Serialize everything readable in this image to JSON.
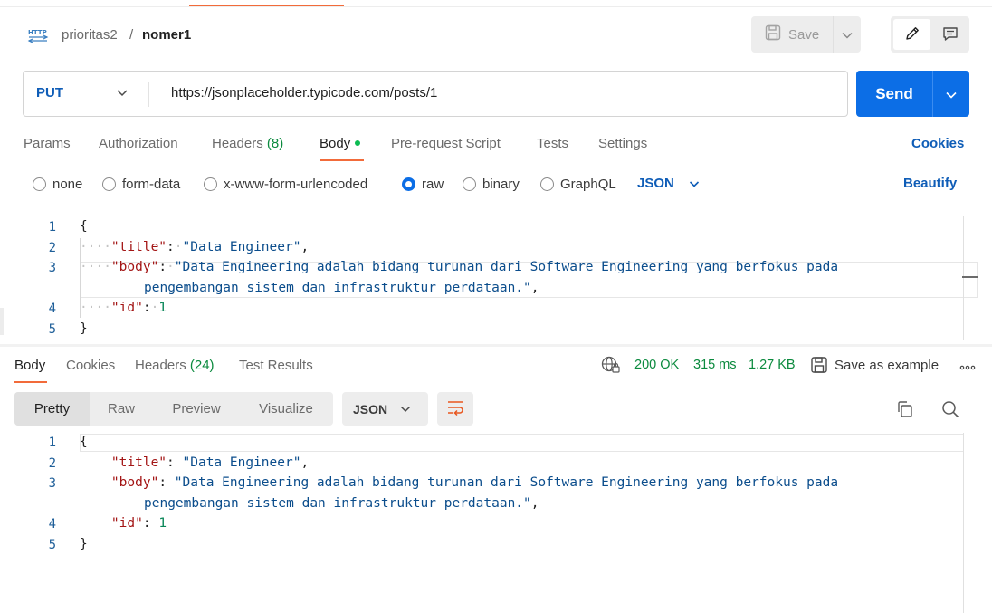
{
  "header": {
    "breadcrumb_parent": "prioritas2",
    "breadcrumb_separator": "/",
    "breadcrumb_current": "nomer1",
    "save_label": "Save"
  },
  "request": {
    "method": "PUT",
    "url": "https://jsonplaceholder.typicode.com/posts/1",
    "send_label": "Send"
  },
  "request_tabs": {
    "params": "Params",
    "authorization": "Authorization",
    "headers": "Headers",
    "headers_count": "(8)",
    "body": "Body",
    "pre_request": "Pre-request Script",
    "tests": "Tests",
    "settings": "Settings",
    "cookies": "Cookies"
  },
  "body_types": {
    "none": "none",
    "form_data": "form-data",
    "urlencoded": "x-www-form-urlencoded",
    "raw": "raw",
    "binary": "binary",
    "graphql": "GraphQL",
    "selected": "raw",
    "language": "JSON",
    "beautify": "Beautify"
  },
  "request_editor": {
    "line_numbers": [
      "1",
      "2",
      "3",
      "4",
      "5"
    ],
    "open_brace": "{",
    "close_brace": "}",
    "key_title": "\"title\"",
    "val_title": "\"Data Engineer\"",
    "key_body": "\"body\"",
    "val_body_1": "\"Data Engineering adalah bidang turunan dari Software Engineering yang berfokus pada",
    "val_body_2": "pengembangan sistem dan infrastruktur perdataan.\"",
    "key_id": "\"id\"",
    "val_id": "1"
  },
  "response_tabs": {
    "body": "Body",
    "cookies": "Cookies",
    "headers": "Headers",
    "headers_count": "(24)",
    "test_results": "Test Results"
  },
  "response_status": {
    "code": "200 OK",
    "time": "315 ms",
    "size": "1.27 KB",
    "save_example": "Save as example"
  },
  "response_view": {
    "pretty": "Pretty",
    "raw": "Raw",
    "preview": "Preview",
    "visualize": "Visualize",
    "language": "JSON"
  },
  "response_editor": {
    "line_numbers": [
      "1",
      "2",
      "3",
      "4",
      "5"
    ],
    "open_brace": "{",
    "close_brace": "}",
    "key_title": "\"title\"",
    "val_title": "\"Data Engineer\"",
    "key_body": "\"body\"",
    "val_body_1": "\"Data Engineering adalah bidang turunan dari Software Engineering yang berfokus pada",
    "val_body_2": "pengembangan sistem dan infrastruktur perdataan.\"",
    "key_id": "\"id\"",
    "val_id": "1"
  },
  "colors": {
    "accent": "#f26b3a",
    "primary": "#0c6ee6",
    "status_green": "#0b8a3e"
  },
  "icons": {
    "request_type": "http-icon",
    "save": "save-icon",
    "edit": "pencil-icon",
    "comment": "comment-icon",
    "network": "globe-lock-icon",
    "copy": "copy-icon",
    "search": "search-icon",
    "wrap": "wrap-lines-icon",
    "more": "more-horizontal-icon"
  }
}
